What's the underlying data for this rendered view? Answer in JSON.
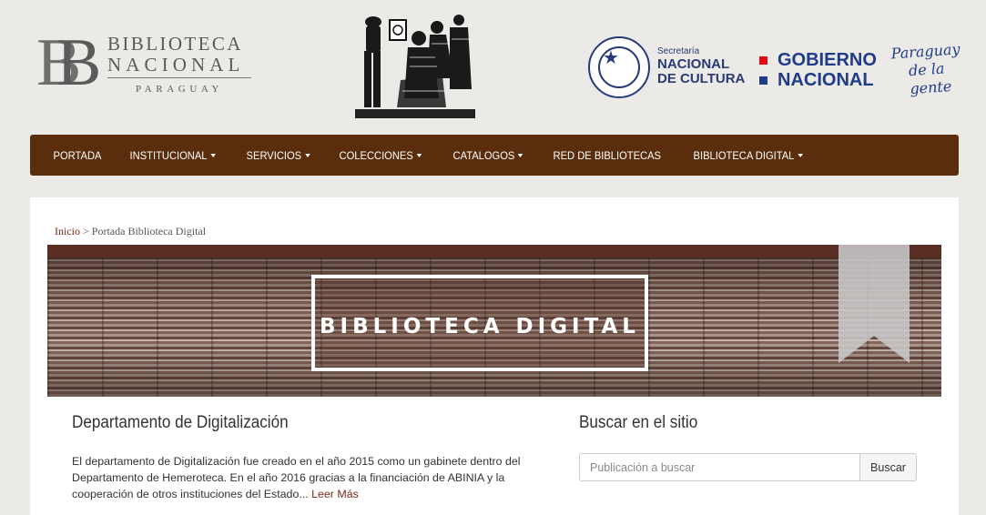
{
  "header": {
    "library_logo": {
      "line1": "BIBLIOTECA",
      "line2": "NACIONAL",
      "line3": "PARAGUAY",
      "monogram": "BN"
    },
    "woodcut_illustration": "woodcut-illustration",
    "gov_logos": {
      "seal_text": "REPÚBLICA DEL PARAGUAY",
      "cultura_small": "Secretaría",
      "cultura_line1": "NACIONAL",
      "cultura_line2": "DE CULTURA",
      "gobierno_line1": "GOBIERNO",
      "gobierno_line2": "NACIONAL",
      "paraguay_line1": "Paraguay",
      "paraguay_line2": "de la gente"
    }
  },
  "nav": {
    "items": [
      {
        "label": "PORTADA",
        "dropdown": false
      },
      {
        "label": "INSTITUCIONAL",
        "dropdown": true
      },
      {
        "label": "SERVICIOS",
        "dropdown": true
      },
      {
        "label": "COLECCIONES",
        "dropdown": true
      },
      {
        "label": "CATALOGOS",
        "dropdown": true
      },
      {
        "label": "RED DE BIBLIOTECAS",
        "dropdown": false
      },
      {
        "label": "BIBLIOTECA DIGITAL",
        "dropdown": true
      }
    ]
  },
  "breadcrumb": {
    "home": "Inicio",
    "separator": ">",
    "current": "Portada Biblioteca Digital"
  },
  "banner": {
    "title": "BIBLIOTECA DIGITAL"
  },
  "department": {
    "title": "Departamento de Digitalización",
    "text": "El departamento de Digitalización fue creado en el año 2015 como un gabinete dentro del Departamento de Hemeroteca. En el año 2016 gracias a la financiación de ABINIA y la cooperación de otros instituciones del Estado...",
    "more_link": "Leer Más"
  },
  "search": {
    "title": "Buscar en el sitio",
    "placeholder": "Publicación a buscar",
    "button": "Buscar"
  },
  "colors": {
    "nav_bg": "#5a2e0c",
    "page_bg": "#ebeae6",
    "link": "#7a2a1a",
    "gov_blue": "#1f3c88",
    "gov_red": "#e30613"
  }
}
